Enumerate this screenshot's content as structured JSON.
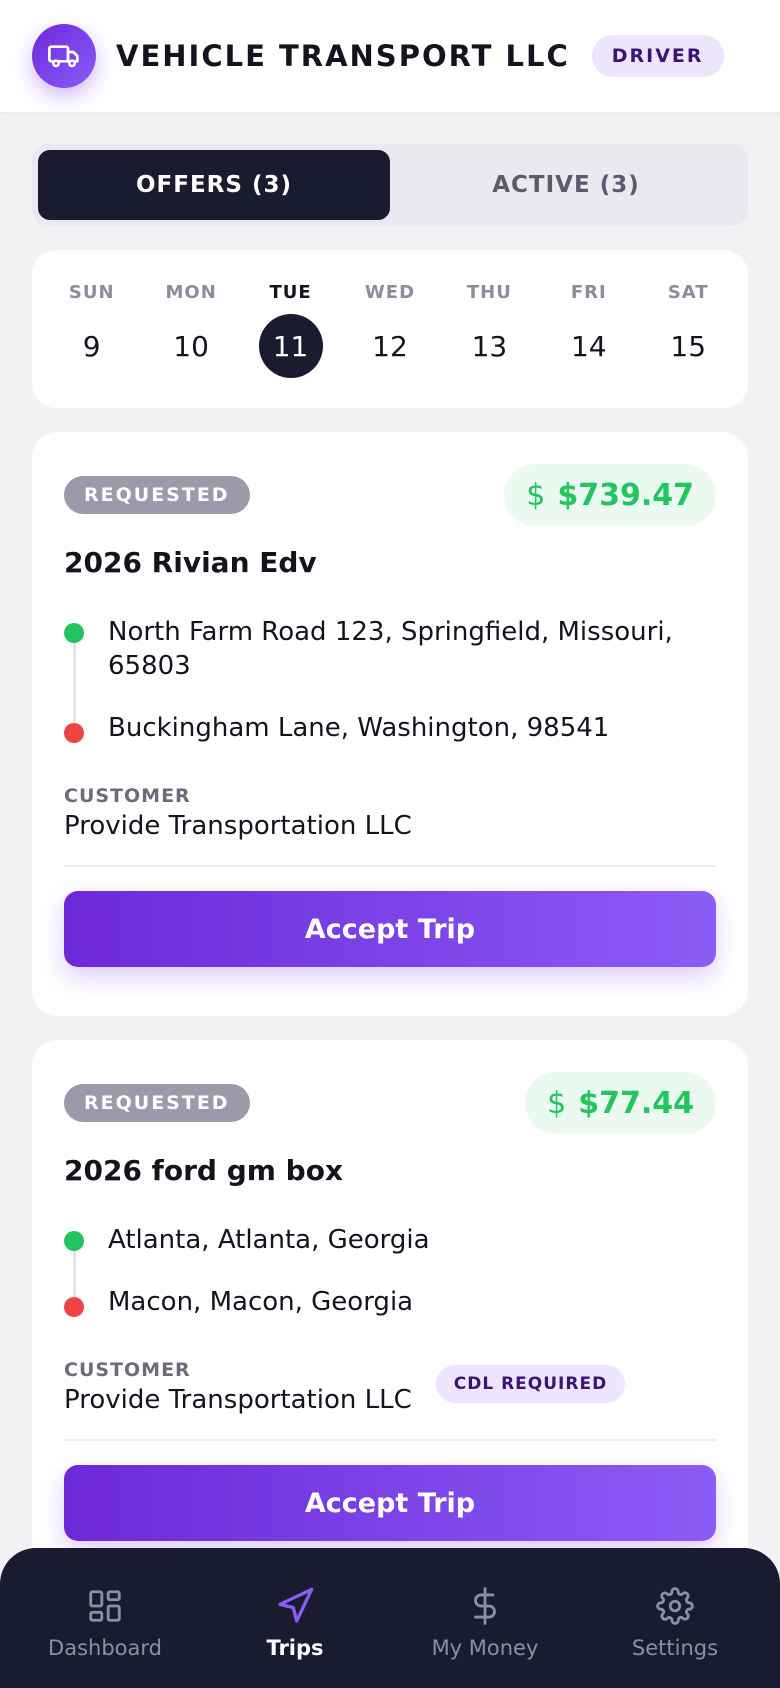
{
  "header": {
    "company_name": "VEHICLE TRANSPORT LLC",
    "role_badge": "DRIVER",
    "logo_icon": "truck-icon"
  },
  "tabs": [
    {
      "label": "OFFERS (3)",
      "active": true
    },
    {
      "label": "ACTIVE (3)",
      "active": false
    }
  ],
  "calendar": {
    "days": [
      {
        "name": "SUN",
        "num": "9",
        "selected": false
      },
      {
        "name": "MON",
        "num": "10",
        "selected": false
      },
      {
        "name": "TUE",
        "num": "11",
        "selected": true
      },
      {
        "name": "WED",
        "num": "12",
        "selected": false
      },
      {
        "name": "THU",
        "num": "13",
        "selected": false
      },
      {
        "name": "FRI",
        "num": "14",
        "selected": false
      },
      {
        "name": "SAT",
        "num": "15",
        "selected": false
      }
    ]
  },
  "trips": [
    {
      "status": "REQUESTED",
      "price_symbol": "$",
      "price": "$739.47",
      "vehicle": "2026 Rivian Edv",
      "pickup": "North Farm Road 123, Springfield, Missouri, 65803",
      "dropoff": "Buckingham Lane, Washington, 98541",
      "customer_label": "CUSTOMER",
      "customer": "Provide Transportation LLC",
      "accept_label": "Accept Trip"
    },
    {
      "status": "REQUESTED",
      "price_symbol": "$",
      "price": "$77.44",
      "vehicle": "2026 ford gm box",
      "pickup": "Atlanta, Atlanta, Georgia",
      "dropoff": "Macon, Macon, Georgia",
      "customer_label": "CUSTOMER",
      "customer": "Provide Transportation LLC",
      "cdl_badge": "CDL REQUIRED",
      "accept_label": "Accept Trip"
    }
  ],
  "bottom_nav": [
    {
      "label": "Dashboard",
      "icon": "dashboard-icon",
      "active": false
    },
    {
      "label": "Trips",
      "icon": "navigation-arrow-icon",
      "active": true
    },
    {
      "label": "My Money",
      "icon": "dollar-icon",
      "active": false
    },
    {
      "label": "Settings",
      "icon": "gear-icon",
      "active": false
    }
  ],
  "colors": {
    "accent": "#7c3aed",
    "dark": "#1a1b2e",
    "price_green": "#22c55e",
    "dropoff_red": "#ef4444"
  }
}
